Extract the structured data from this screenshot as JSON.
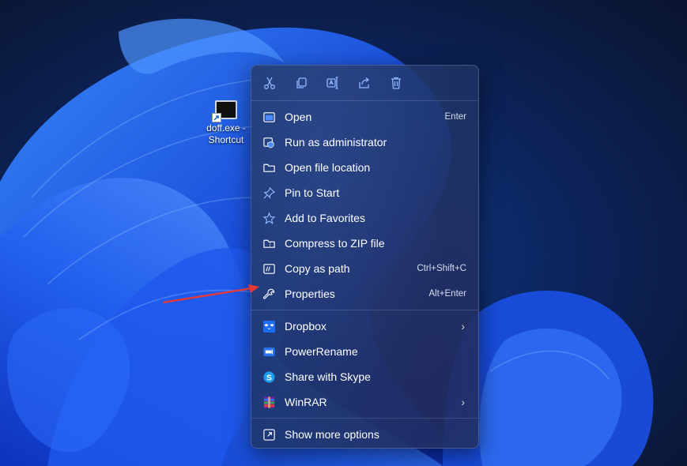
{
  "desktop": {
    "shortcut_label_line1": "doff.exe -",
    "shortcut_label_line2": "Shortcut"
  },
  "context_menu": {
    "toolbar": [
      {
        "name": "cut",
        "icon": "scissors-icon"
      },
      {
        "name": "copy",
        "icon": "copy-icon"
      },
      {
        "name": "rename",
        "icon": "rename-icon"
      },
      {
        "name": "share",
        "icon": "share-icon"
      },
      {
        "name": "delete",
        "icon": "trash-icon"
      }
    ],
    "items": [
      {
        "label": "Open",
        "shortcut": "Enter",
        "icon": "open-window-icon"
      },
      {
        "label": "Run as administrator",
        "shortcut": "",
        "icon": "shield-icon"
      },
      {
        "label": "Open file location",
        "shortcut": "",
        "icon": "folder-icon"
      },
      {
        "label": "Pin to Start",
        "shortcut": "",
        "icon": "pin-icon"
      },
      {
        "label": "Add to Favorites",
        "shortcut": "",
        "icon": "star-icon"
      },
      {
        "label": "Compress to ZIP file",
        "shortcut": "",
        "icon": "zip-folder-icon"
      },
      {
        "label": "Copy as path",
        "shortcut": "Ctrl+Shift+C",
        "icon": "path-icon"
      },
      {
        "label": "Properties",
        "shortcut": "Alt+Enter",
        "icon": "wrench-icon"
      }
    ],
    "app_items": [
      {
        "label": "Dropbox",
        "submenu": "›",
        "icon": "dropbox-icon"
      },
      {
        "label": "PowerRename",
        "submenu": "",
        "icon": "powerrename-icon"
      },
      {
        "label": "Share with Skype",
        "submenu": "",
        "icon": "skype-icon"
      },
      {
        "label": "WinRAR",
        "submenu": "›",
        "icon": "winrar-icon"
      }
    ],
    "more": {
      "label": "Show more options",
      "icon": "more-options-icon"
    }
  },
  "colors": {
    "accent": "#2f6fe0",
    "menu_bg": "#20346480",
    "annotation_arrow": "#e53935"
  }
}
